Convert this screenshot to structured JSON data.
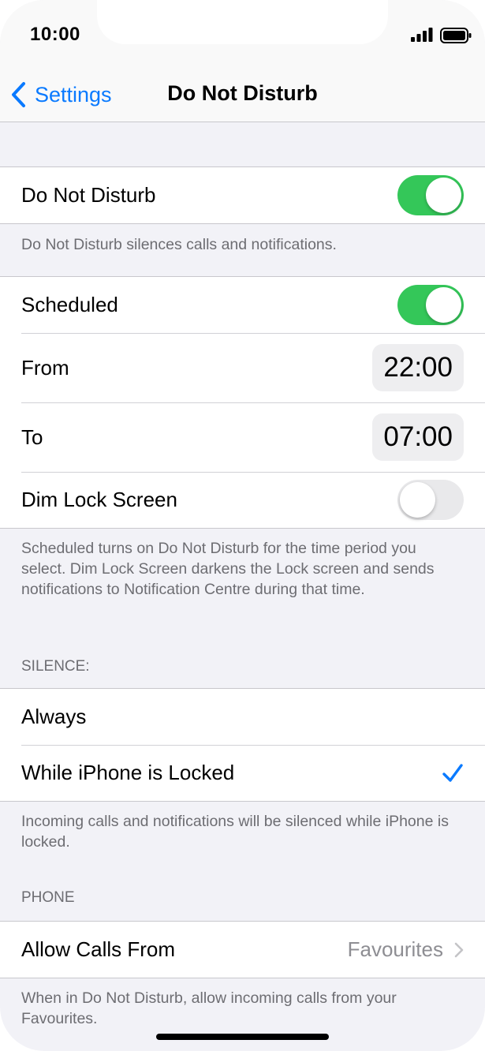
{
  "status_bar": {
    "time": "10:00"
  },
  "nav": {
    "back_label": "Settings",
    "title": "Do Not Disturb"
  },
  "dnd_section": {
    "toggle_label": "Do Not Disturb",
    "toggle_on": true,
    "footer": "Do Not Disturb silences calls and notifications."
  },
  "schedule_section": {
    "scheduled_label": "Scheduled",
    "scheduled_on": true,
    "from_label": "From",
    "from_value": "22:00",
    "to_label": "To",
    "to_value": "07:00",
    "dim_label": "Dim Lock Screen",
    "dim_on": false,
    "footer": "Scheduled turns on Do Not Disturb for the time period you select. Dim Lock Screen darkens the Lock screen and sends notifications to Notification Centre during that time."
  },
  "silence_section": {
    "header": "SILENCE:",
    "options": [
      {
        "label": "Always",
        "selected": false
      },
      {
        "label": "While iPhone is Locked",
        "selected": true
      }
    ],
    "footer": "Incoming calls and notifications will be silenced while iPhone is locked."
  },
  "phone_section": {
    "header": "PHONE",
    "allow_calls_label": "Allow Calls From",
    "allow_calls_value": "Favourites",
    "footer": "When in Do Not Disturb, allow incoming calls from your Favourites."
  },
  "colors": {
    "accent": "#0a7aff",
    "toggle_on": "#34c759",
    "toggle_off": "#e9e9eb",
    "background": "#f2f2f7",
    "secondary_text": "#6d6d72"
  },
  "icons": {
    "back": "chevron-left-icon",
    "selected": "checkmark-icon",
    "disclosure": "chevron-right-icon",
    "signal": "signal-icon",
    "battery": "battery-icon"
  }
}
